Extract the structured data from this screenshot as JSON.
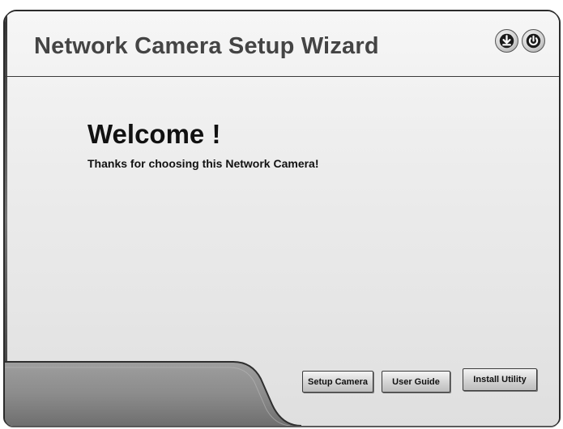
{
  "window": {
    "title": "Network Camera Setup Wizard"
  },
  "header_icons": [
    {
      "name": "download-icon"
    },
    {
      "name": "power-icon"
    }
  ],
  "content": {
    "heading": "Welcome !",
    "subtext": "Thanks for choosing this Network Camera!"
  },
  "buttons": {
    "setup_camera": "Setup Camera",
    "user_guide": "User Guide",
    "install_utility": "Install Utility"
  }
}
